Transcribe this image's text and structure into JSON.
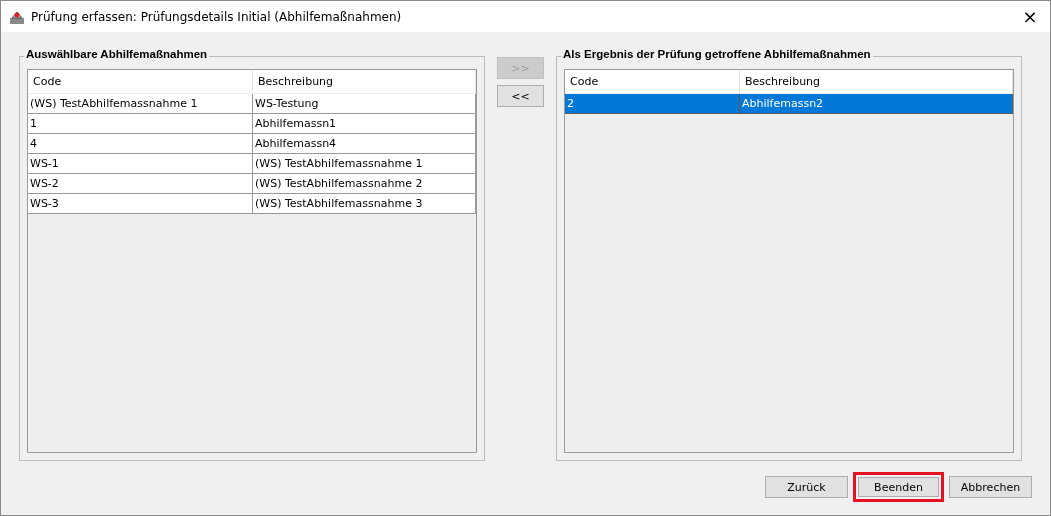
{
  "window": {
    "title": "Prüfung erfassen: Prüfungsdetails Initial (Abhilfemaßnahmen)",
    "close": "×"
  },
  "available": {
    "title": "Auswählbare Abhilfemaßnahmen",
    "columns": [
      "Code",
      "Beschreibung"
    ],
    "rows": [
      {
        "cells": [
          "(WS) TestAbhilfemassnahme 1",
          "WS-Testung"
        ],
        "selected": false
      },
      {
        "cells": [
          "1",
          "Abhilfemassn1"
        ],
        "selected": false
      },
      {
        "cells": [
          "4",
          "Abhilfemassn4"
        ],
        "selected": false
      },
      {
        "cells": [
          "WS-1",
          "(WS) TestAbhilfemassnahme 1"
        ],
        "selected": false
      },
      {
        "cells": [
          "WS-2",
          "(WS) TestAbhilfemassnahme 2"
        ],
        "selected": false
      },
      {
        "cells": [
          "WS-3",
          "(WS) TestAbhilfemassnahme 3"
        ],
        "selected": false
      }
    ]
  },
  "transfer": [
    {
      "label": ">>",
      "disabled": true
    },
    {
      "label": "<<",
      "disabled": false
    }
  ],
  "chosen": {
    "title": "Als Ergebnis der Prüfung getroffene Abhilfemaßnahmen",
    "columns": [
      "Code",
      "Beschreibung"
    ],
    "rows": [
      {
        "cells": [
          "2",
          "Abhilfemassn2"
        ],
        "selected": true
      }
    ]
  },
  "buttons": [
    {
      "label": "Zurück",
      "highlighted": false
    },
    {
      "label": "Beenden",
      "highlighted": true
    },
    {
      "label": "Abbrechen",
      "highlighted": false
    }
  ]
}
